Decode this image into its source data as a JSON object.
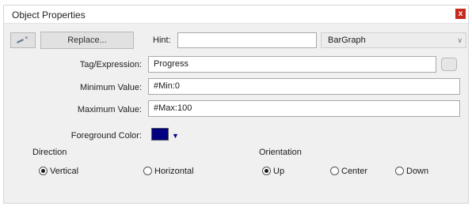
{
  "window": {
    "title": "Object Properties",
    "close": "x"
  },
  "toolbar": {
    "tool_icon": "wand-icon",
    "replace_label": "Replace...",
    "hint_label": "Hint:",
    "hint_value": "",
    "type_value": "BarGraph"
  },
  "form": {
    "tag_label": "Tag/Expression:",
    "tag_value": "Progress",
    "min_label": "Minimum Value:",
    "min_value": "#Min:0",
    "max_label": "Maximum Value:",
    "max_value": "#Max:100",
    "fg_label": "Foreground Color:",
    "fg_color": "#000080"
  },
  "direction": {
    "label": "Direction",
    "options": [
      {
        "label": "Vertical",
        "checked": true
      },
      {
        "label": "Horizontal",
        "checked": false
      }
    ]
  },
  "orientation": {
    "label": "Orientation",
    "options": [
      {
        "label": "Up",
        "checked": true
      },
      {
        "label": "Center",
        "checked": false
      },
      {
        "label": "Down",
        "checked": false
      }
    ]
  }
}
